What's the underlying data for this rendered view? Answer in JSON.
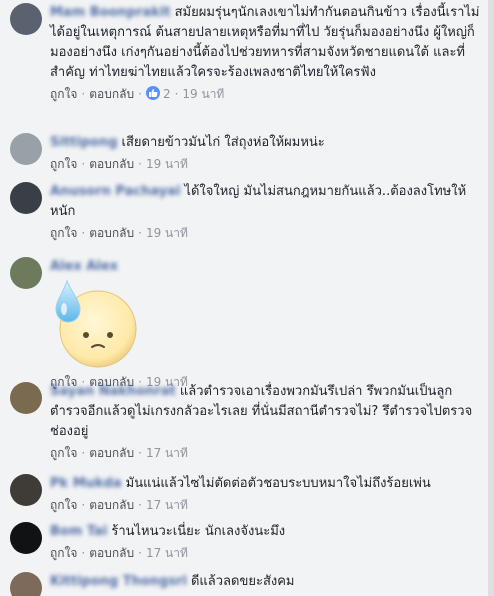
{
  "actions": {
    "like": "ถูกใจ",
    "reply": "ตอบกลับ",
    "separator": "·"
  },
  "comments": [
    {
      "author": "Mam Boonprakit",
      "text": "สมัยผมรุ่นๆนักเลงเขาไม่ทำกันตอนกินข้าว เรื่องนี้เราไม่ได้อยู่ในเหตุการณ์ ต้นสายปลายเหตุหรือที่มาที่ไป วัยรุ่นก็มองอย่างนึง ผู้ใหญ่ก็มองอย่างนึง เก่งๆกันอย่างนี้ต้องไปช่วยทหารที่สามจังหวัดชายแดนใต้ และที่สำคัญ ท่าไทยฆ่าไทยแล้วใครจะร้องเพลงชาติไทยให้ใครฟัง",
      "like_count": "2",
      "time": "19 นาที",
      "avatar_color": "#5a6270"
    },
    {
      "author": "Sittipong",
      "text": "เสียดายข้าวมันไก่ ใส่ถุงห่อให้ผมหน่ะ",
      "time": "19 นาที",
      "avatar_color": "#9aa0a8"
    },
    {
      "author": "Anusorn Pachayai",
      "text": "ได้ใจใหญ่ มันไม่สนกฎหมายกันแล้ว..ต้องลงโทษให้หนัก",
      "time": "19 นาที",
      "avatar_color": "#3a3f47"
    },
    {
      "author": "Alex Alex",
      "text": "",
      "time": "19 นาที",
      "avatar_color": "#6d7a5c",
      "sticker": "sweat-face-sticker"
    },
    {
      "author": "Sayan Nakhonrat",
      "text": "แล้วตำรวจเอาเรื่องพวกมันรึเปล่า รึพวกมันเป็นลูกตำรวจอีกแล้วดูไม่เกรงกลัวอะไรเลย ที่นั่นมีสถานีตำรวจไม่? รึตำรวจไปตรวจช่องอยู่",
      "time": "17 นาที",
      "avatar_color": "#7a6a4f"
    },
    {
      "author": "Pk Mukda",
      "text": "มันแน่แล้วไซไม่ตัดต่อตัวชอบระบบหมาใจไม่ถึงร้อยเพ่น",
      "time": "17 นาที",
      "avatar_color": "#3f3b37"
    },
    {
      "author": "Bom Tai",
      "text": "ร้านไหนวะเนี่ยะ นักเลงจังนะมึง",
      "time": "17 นาที",
      "avatar_color": "#101214"
    },
    {
      "author": "Kittipong Thongsri",
      "text": "ดีแล้วลดขยะสังคม",
      "time": "",
      "avatar_color": "#7d6a5a"
    }
  ]
}
